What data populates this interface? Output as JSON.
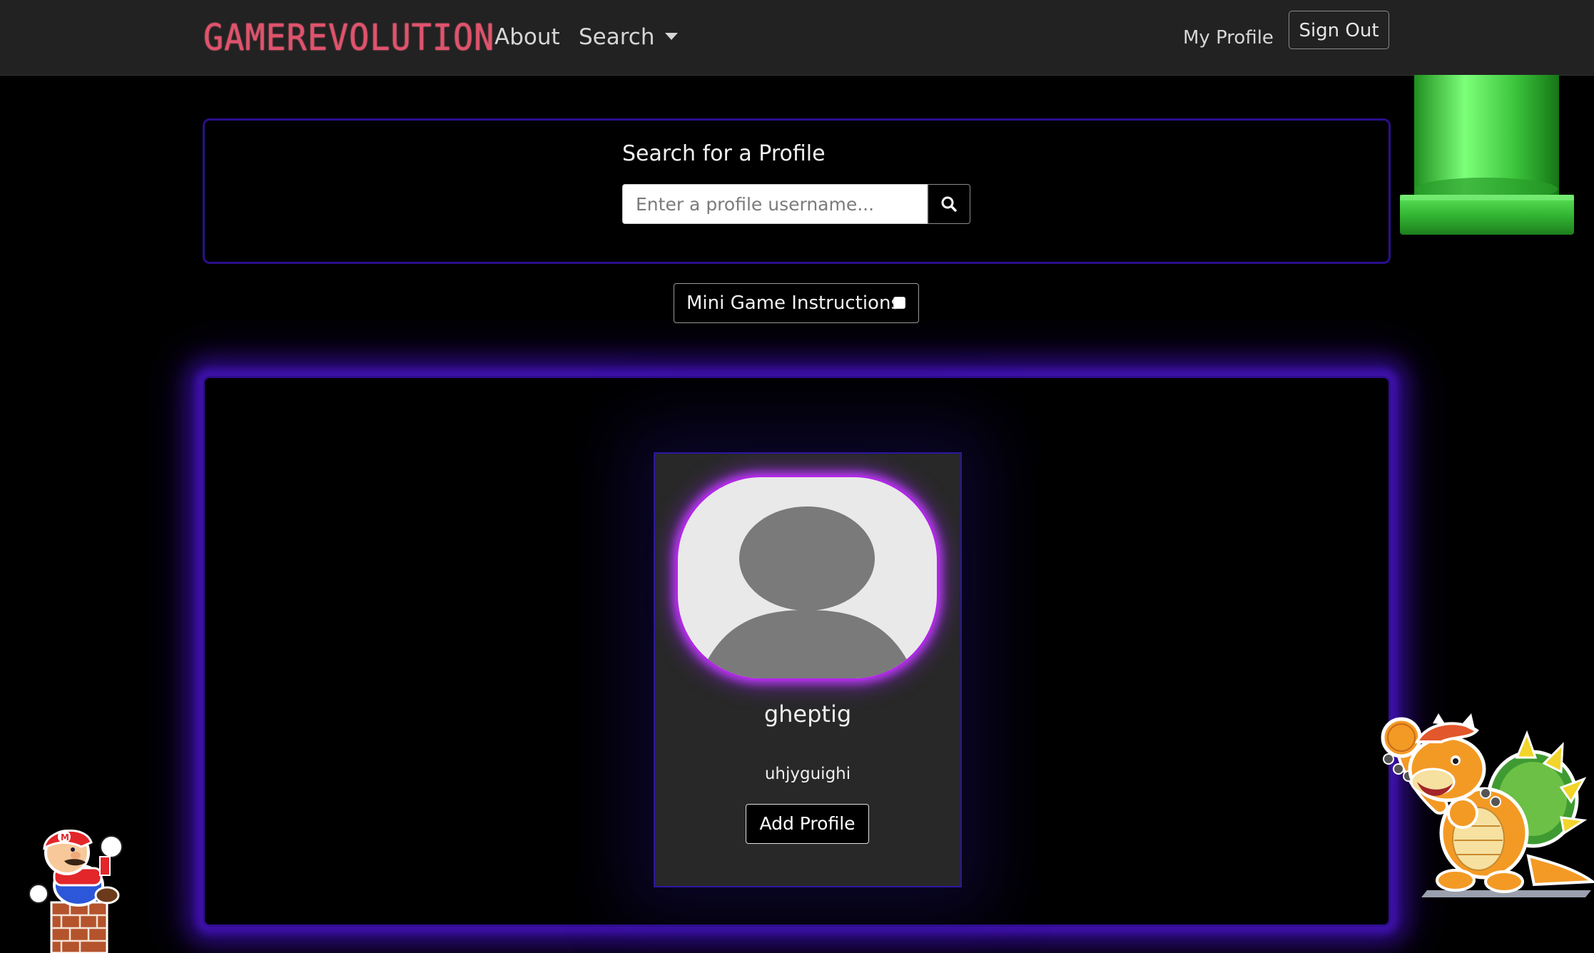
{
  "navbar": {
    "brand": "GAMEREVOLUTION",
    "about": "About",
    "search": "Search",
    "my_profile": "My Profile",
    "sign_out": "Sign Out"
  },
  "search": {
    "title": "Search for a Profile",
    "placeholder": "Enter a profile username...",
    "button_icon": "search-icon"
  },
  "mini_game": {
    "label": "Mini Game Instructions",
    "checked": false
  },
  "profile_card": {
    "username": "gheptig",
    "subtitle": "uhjyguighi",
    "add_button": "Add Profile",
    "avatar_icon": "default-user-avatar"
  },
  "decorations": {
    "top_right": "green-warp-pipe",
    "bottom_left": "mario-on-brick-pillar",
    "bottom_right": "bowser"
  },
  "colors": {
    "background": "#000000",
    "navbar": "#222222",
    "brand": "#e0536c",
    "panel_border": "#2f0e8e",
    "avatar_glow": "#b027e6",
    "card": "#282828"
  }
}
